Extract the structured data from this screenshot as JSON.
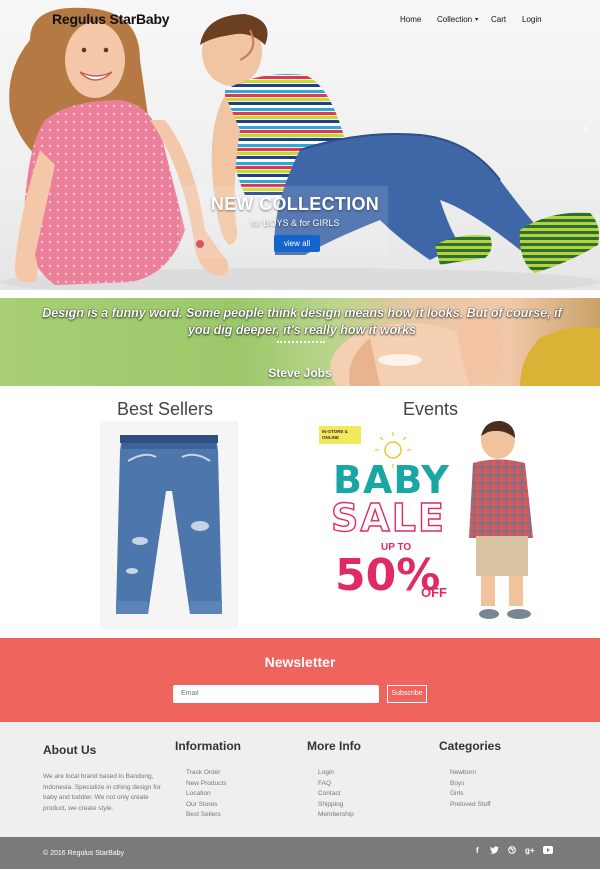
{
  "header": {
    "brand": "Regulus StarBaby",
    "nav": {
      "home": "Home",
      "collection": "Collection",
      "cart": "Cart",
      "login": "Login"
    }
  },
  "hero": {
    "title": "NEW COLLECTION",
    "subtitle": "for BOYS & for GIRLS",
    "button": "view all"
  },
  "quote": {
    "text": "Design is a funny word. Some people think design means how it looks. But of course, if you dig deeper, it's really how it works",
    "author": "Steve Jobs"
  },
  "sections": {
    "best_sellers": "Best Sellers",
    "events": "Events",
    "event_banner": {
      "tag": "IN-STORE & ONLINE",
      "line1": "BABY",
      "line2": "SALE",
      "upto": "UP TO",
      "percent": "50%",
      "off": "OFF"
    }
  },
  "newsletter": {
    "title": "Newsletter",
    "placeholder": "Email",
    "button": "Subscribe"
  },
  "footer": {
    "about": {
      "title": "About Us",
      "text": "We are local brand based in Bandung, Indonesia. Specialize in cthing design for baby and toddler. We not only create product, we create style."
    },
    "information": {
      "title": "Information",
      "items": [
        "Track Order",
        "New Products",
        "Location",
        "Our Stores",
        "Best Sellers"
      ]
    },
    "more_info": {
      "title": "More Info",
      "items": [
        "Login",
        "FAQ",
        "Contact",
        "Shipping",
        "Membership"
      ]
    },
    "categories": {
      "title": "Categories",
      "items": [
        "Newborn",
        "Boys",
        "Girls",
        "Preloved Stuff"
      ]
    },
    "copyright": "© 2016 Regulus StarBaby",
    "socials": [
      "facebook-icon",
      "twitter-icon",
      "dribbble-icon",
      "google-plus-icon",
      "youtube-icon"
    ]
  },
  "colors": {
    "newsletter_bg": "#ef645c",
    "footer_bg": "#efefef",
    "bottom_bar": "#7a7a7a",
    "button_blue": "#1464cc",
    "sale_teal": "#1aa7a3",
    "sale_pink": "#e02a63"
  }
}
